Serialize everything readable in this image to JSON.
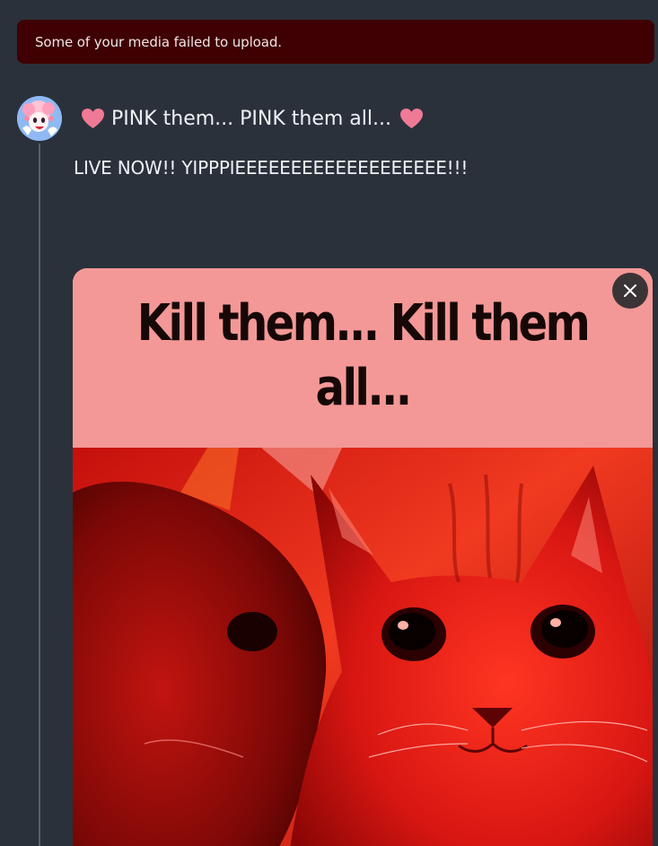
{
  "error_banner": {
    "message": "Some of your media failed to upload."
  },
  "post": {
    "author_display_name": "PINK them... PINK them all...",
    "body": "LIVE NOW!! YIPPPIEEEEEEEEEEEEEEEEEEE!!!",
    "media": {
      "caption_text": "Kill them... Kill them all...",
      "description_icon": "cat-meme-image"
    }
  },
  "icons": {
    "heart": "heart-icon",
    "close": "close-icon",
    "avatar": "avatar-icon"
  },
  "colors": {
    "background": "#2a313b",
    "error_banner": "#3f0003",
    "heart": "#ef7a96",
    "meme_pink": "#f39896",
    "meme_red": "#e21a14",
    "remove_button": "#3b3437"
  }
}
